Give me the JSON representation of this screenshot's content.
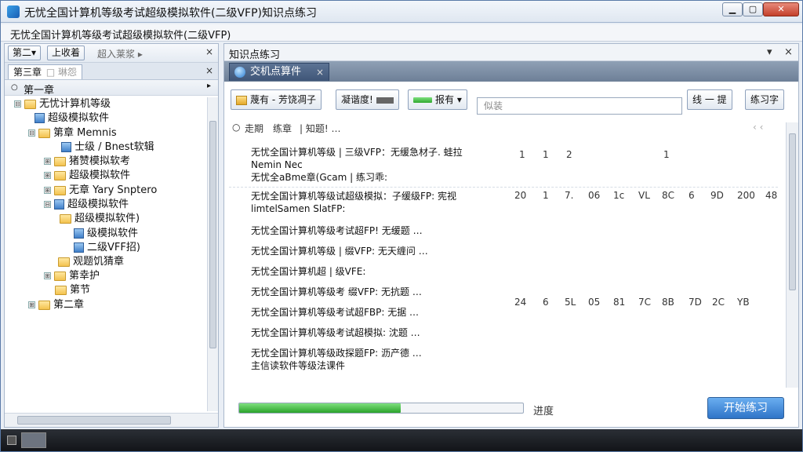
{
  "window": {
    "title": "无忧全国计算机等级考试超级模拟软件(二级VFP)知识点练习",
    "subtitle": "无忧全国计算机等级考试超级模拟软件(二级VFP)",
    "controls": {
      "minimize": "▁",
      "maximize": "▢",
      "close": "✕"
    }
  },
  "left_pane": {
    "toolbar": {
      "btn1": "第二▾",
      "btn2": "上收着",
      "label": "超入莱浆 ▸",
      "close": "×"
    },
    "tab": {
      "label1": "第三章",
      "label2": "□ 琳怨",
      "close": "×"
    },
    "tree_head": {
      "title": "第一章",
      "arrow": "▸"
    },
    "tree": [
      {
        "label": "无忧计算机等级",
        "expander": "⊟",
        "icon": "folder"
      },
      {
        "label": "超级模拟软件",
        "icon": "doc"
      },
      {
        "label": "第章 Memnis",
        "expander": "⊟",
        "icon": "folder"
      },
      {
        "label": "士级 / Bnest软辑",
        "icon": "doc"
      },
      {
        "label": "猪赞模拟软考",
        "expander": "⊞",
        "icon": "folder"
      },
      {
        "label": "超级模拟软件",
        "expander": "⊞",
        "icon": "folder"
      },
      {
        "label": "无章 Yary Snptero",
        "expander": "⊞",
        "icon": "folder"
      },
      {
        "label": "超级模拟软件",
        "expander": "⊟",
        "icon": "doc"
      },
      {
        "label": "超级模拟软件)",
        "icon": "folder"
      },
      {
        "label": "级模拟软件",
        "icon": "doc"
      },
      {
        "label": "二级VFF招)",
        "icon": "doc"
      },
      {
        "label": "观题饥猜章",
        "icon": "folder"
      },
      {
        "label": "第幸护",
        "expander": "⊞",
        "icon": "folder"
      },
      {
        "label": "第节",
        "icon": "folder"
      },
      {
        "label": "第二章",
        "expander": "⊞",
        "icon": "folder"
      }
    ]
  },
  "right_pane": {
    "title": "知识点练习",
    "title_controls": {
      "dropdown": "▾",
      "close": "×"
    },
    "tab": {
      "label": "交机点算件",
      "close": "×"
    },
    "controls": {
      "btn1": "蔑有 - 芳饶凋子",
      "btn2": "凝谐度!",
      "btn3": "报有 ▾",
      "search_placeholder": "似装",
      "btn4": "线 一 提",
      "btn5": "练习字"
    },
    "filter": {
      "radio": "○",
      "a": "走期",
      "b": "练章",
      "c": "| 知题! …",
      "right": "‹ ‹"
    },
    "rows": [
      {
        "line1": "无忧全国计算机等级 | 三级VFP：无缓急材子. 蛙拉",
        "line2": "Nemin Nec",
        "line3": "无忧全aBme章(Gcam | 练习乖:"
      },
      {
        "line1": "无忧全国计算机等级试超级模拟：子缓级FP: 宪视",
        "line2": "limtelSamen SlatFP:"
      },
      {
        "line1": "无忧全国计算机等级考试超FP! 无缓题 …"
      },
      {
        "line1": "无忧全国计算机等级 | 缀VFP: 无天缠问 …"
      },
      {
        "line1": "无忧全国计算机超 | 级VFE:"
      },
      {
        "line1": "无忧全国计算机等级考 缀VFP: 无抗题 …"
      },
      {
        "line1": "无忧全国计算机等级考试超FBP: 无据 …"
      },
      {
        "line1": "无忧全国计算机等级考试超模拟: 沈题 …"
      },
      {
        "line1": "无忧全国计算机等级政探题FP: 沥产德 …",
        "line2": "主信读软件等级法课件"
      }
    ],
    "nums_row1": [
      "1",
      "1",
      "2",
      "1"
    ],
    "nums_row2": [
      "20",
      "1",
      "7.",
      "06",
      "1c",
      "VL",
      "8C",
      "6",
      "9D",
      "200",
      "48"
    ],
    "nums_row3": [
      "24",
      "6",
      "5L",
      "05",
      "81",
      "7C",
      "8B",
      "7D",
      "2C",
      "YB"
    ],
    "progress": {
      "value": 0.57,
      "label": "进度"
    },
    "start_button": "开始练习"
  },
  "colors": {
    "progress": "#2aa32a",
    "accent": "#2f74c8"
  }
}
